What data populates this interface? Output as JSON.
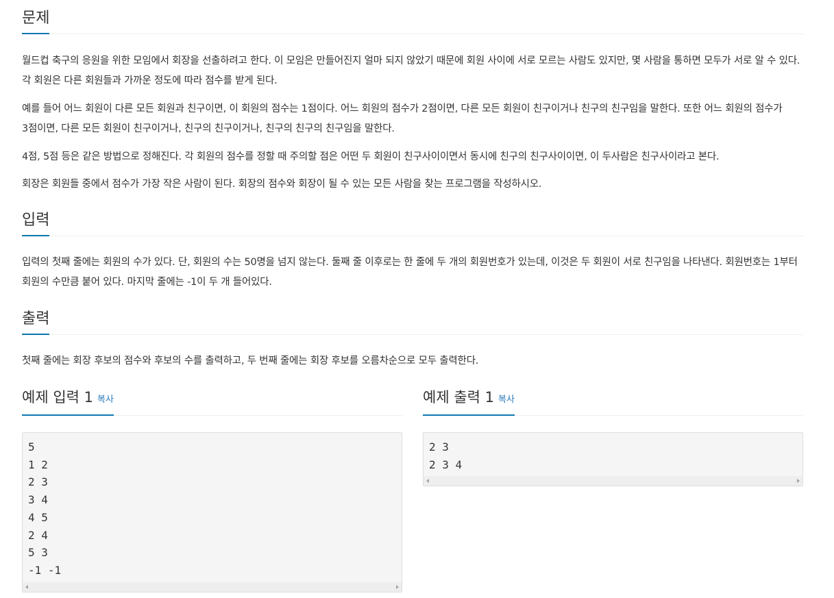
{
  "problem": {
    "title": "문제",
    "paragraphs": [
      "월드컵 축구의 응원을 위한 모임에서 회장을 선출하려고 한다. 이 모임은 만들어진지 얼마 되지 않았기 때문에 회원 사이에 서로 모르는 사람도 있지만, 몇 사람을 통하면 모두가 서로 알 수 있다. 각 회원은 다른 회원들과 가까운 정도에 따라 점수를 받게 된다.",
      "예를 들어 어느 회원이 다른 모든 회원과 친구이면, 이 회원의 점수는 1점이다. 어느 회원의 점수가 2점이면, 다른 모든 회원이 친구이거나 친구의 친구임을 말한다. 또한 어느 회원의 점수가 3점이면, 다른 모든 회원이 친구이거나, 친구의 친구이거나, 친구의 친구의 친구임을 말한다.",
      "4점, 5점 등은 같은 방법으로 정해진다. 각 회원의 점수를 정할 때 주의할 점은 어떤 두 회원이 친구사이이면서 동시에 친구의 친구사이이면, 이 두사람은 친구사이라고 본다.",
      "회장은 회원들 중에서 점수가 가장 작은 사람이 된다. 회장의 점수와 회장이 될 수 있는 모든 사람을 찾는 프로그램을 작성하시오."
    ]
  },
  "input": {
    "title": "입력",
    "paragraph": "입력의 첫째 줄에는 회원의 수가 있다. 단, 회원의 수는 50명을 넘지 않는다. 둘째 줄 이후로는 한 줄에 두 개의 회원번호가 있는데, 이것은 두 회원이 서로 친구임을 나타낸다. 회원번호는 1부터 회원의 수만큼 붙어 있다. 마지막 줄에는 -1이 두 개 들어있다."
  },
  "output": {
    "title": "출력",
    "paragraph": "첫째 줄에는 회장 후보의 점수와 후보의 수를 출력하고, 두 번째 줄에는 회장 후보를 오름차순으로 모두 출력한다."
  },
  "example_input": {
    "title": "예제 입력 1",
    "copy_label": "복사",
    "content": "5\n1 2\n2 3\n3 4\n4 5\n2 4\n5 3\n-1 -1"
  },
  "example_output": {
    "title": "예제 출력 1",
    "copy_label": "복사",
    "content": "2 3\n2 3 4"
  },
  "colors": {
    "accent": "#0e76b1",
    "copy_link": "#2a7ab9",
    "pre_background": "#f5f5f5"
  }
}
